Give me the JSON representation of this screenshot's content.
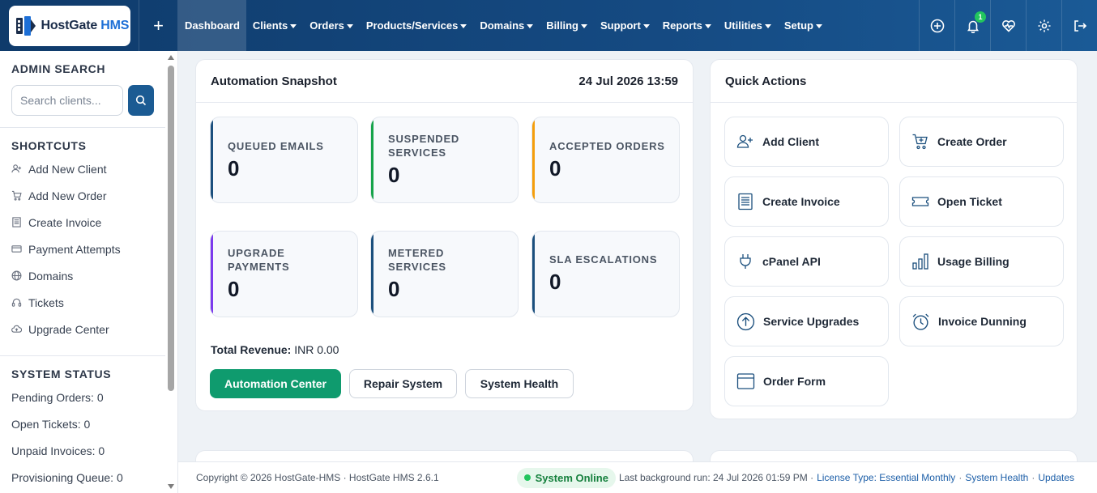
{
  "brand": {
    "name": "HostGate",
    "suffix": "HMS"
  },
  "nav": {
    "add_label": "+",
    "items": [
      {
        "label": "Dashboard",
        "active": true,
        "dropdown": false
      },
      {
        "label": "Clients",
        "dropdown": true
      },
      {
        "label": "Orders",
        "dropdown": true
      },
      {
        "label": "Products/Services",
        "dropdown": true
      },
      {
        "label": "Domains",
        "dropdown": true
      },
      {
        "label": "Billing",
        "dropdown": true
      },
      {
        "label": "Support",
        "dropdown": true
      },
      {
        "label": "Reports",
        "dropdown": true
      },
      {
        "label": "Utilities",
        "dropdown": true
      },
      {
        "label": "Setup",
        "dropdown": true
      }
    ],
    "notification_count": "1",
    "icons": [
      "plus-circle-icon",
      "bell-icon",
      "heartbeat-icon",
      "gear-icon",
      "logout-icon"
    ]
  },
  "sidebar": {
    "admin_search_title": "ADMIN SEARCH",
    "search_placeholder": "Search clients...",
    "shortcuts_title": "SHORTCUTS",
    "shortcuts": [
      {
        "label": "Add New Client",
        "icon": "user-plus-icon"
      },
      {
        "label": "Add New Order",
        "icon": "cart-icon"
      },
      {
        "label": "Create Invoice",
        "icon": "invoice-icon"
      },
      {
        "label": "Payment Attempts",
        "icon": "credit-card-icon"
      },
      {
        "label": "Domains",
        "icon": "globe-icon"
      },
      {
        "label": "Tickets",
        "icon": "headset-icon"
      },
      {
        "label": "Upgrade Center",
        "icon": "cloud-upload-icon"
      }
    ],
    "system_status_title": "SYSTEM STATUS",
    "status": [
      "Pending Orders: 0",
      "Open Tickets: 0",
      "Unpaid Invoices: 0",
      "Provisioning Queue: 0"
    ]
  },
  "snapshot": {
    "title": "Automation Snapshot",
    "datetime": "24 Jul 2026 13:59",
    "stats": [
      {
        "label": "QUEUED EMAILS",
        "value": "0",
        "accent": "#1b4f7d"
      },
      {
        "label": "SUSPENDED SERVICES",
        "value": "0",
        "accent": "#16a34a"
      },
      {
        "label": "ACCEPTED ORDERS",
        "value": "0",
        "accent": "#f59e0b"
      },
      {
        "label": "UPGRADE PAYMENTS",
        "value": "0",
        "accent": "#7c3aed"
      },
      {
        "label": "METERED SERVICES",
        "value": "0",
        "accent": "#1b4f7d"
      },
      {
        "label": "SLA ESCALATIONS",
        "value": "0",
        "accent": "#1b4f7d"
      }
    ],
    "revenue_label": "Total Revenue:",
    "revenue_value": "INR 0.00",
    "buttons": {
      "automation": "Automation Center",
      "repair": "Repair System",
      "health": "System Health"
    }
  },
  "quick_actions": {
    "title": "Quick Actions",
    "items": [
      {
        "label": "Add Client",
        "icon": "user-plus-icon"
      },
      {
        "label": "Create Order",
        "icon": "cart-plus-icon"
      },
      {
        "label": "Create Invoice",
        "icon": "invoice-icon"
      },
      {
        "label": "Open Ticket",
        "icon": "ticket-icon"
      },
      {
        "label": "cPanel API",
        "icon": "plug-icon"
      },
      {
        "label": "Usage Billing",
        "icon": "bar-chart-icon"
      },
      {
        "label": "Service Upgrades",
        "icon": "arrow-up-circle-icon"
      },
      {
        "label": "Invoice Dunning",
        "icon": "alarm-clock-icon"
      },
      {
        "label": "Order Form",
        "icon": "browser-window-icon"
      }
    ]
  },
  "footer": {
    "copyright": "Copyright © 2026 HostGate-HMS · HostGate HMS 2.6.1",
    "status": "System Online",
    "last_run": "Last background run: 24 Jul 2026 01:59 PM ·",
    "license_link": "License Type: Essential Monthly",
    "health_link": "System Health",
    "updates_link": "Updates"
  },
  "colors": {
    "nav_bg": "#154a82",
    "primary": "#0f9b6e",
    "search_btn": "#1b5b93",
    "online": "#22c55e"
  }
}
